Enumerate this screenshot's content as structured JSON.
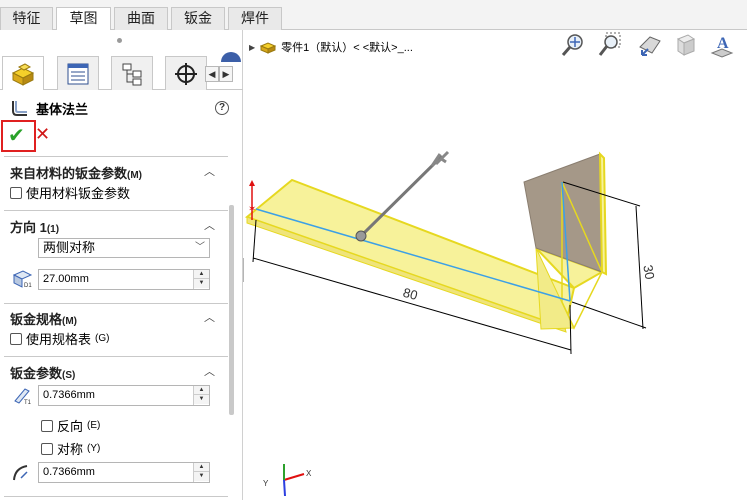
{
  "tabs": [
    "特征",
    "草图",
    "曲面",
    "钣金",
    "焊件"
  ],
  "active_tab": "草图",
  "feature": {
    "title": "基体法兰"
  },
  "sections": {
    "material": {
      "title": "来自材料的钣金参数",
      "title_key": "(M)",
      "checkbox_label": "使用材料钣金参数"
    },
    "direction": {
      "title": "方向 1",
      "title_key": "(1)",
      "end_condition": "两侧对称",
      "depth": "27.00mm"
    },
    "gauge": {
      "title": "钣金规格",
      "title_key": "(M)",
      "checkbox_label": "使用规格表",
      "checkbox_key": "(G)"
    },
    "params": {
      "title": "钣金参数",
      "title_key": "(S)",
      "thickness": "0.7366mm",
      "reverse_label": "反向",
      "reverse_key": "(E)",
      "symmetric_label": "对称",
      "symmetric_key": "(Y)",
      "bend_radius": "0.7366mm"
    }
  },
  "tree": {
    "label": "零件1（默认）< <默认>_..."
  },
  "dimensions": {
    "length": "80",
    "height": "30"
  },
  "icons": [
    "zoom-fit-icon",
    "zoom-area-icon",
    "previous-view-icon",
    "section-view-icon",
    "text-annotation-icon"
  ],
  "colors": {
    "part_fill": "#f7f29a",
    "part_edge": "#e8dc20",
    "plane_fill": "#a59888",
    "sketch_line": "#3ca0e6",
    "ok": "#2aa22a",
    "cancel": "#d01818"
  }
}
